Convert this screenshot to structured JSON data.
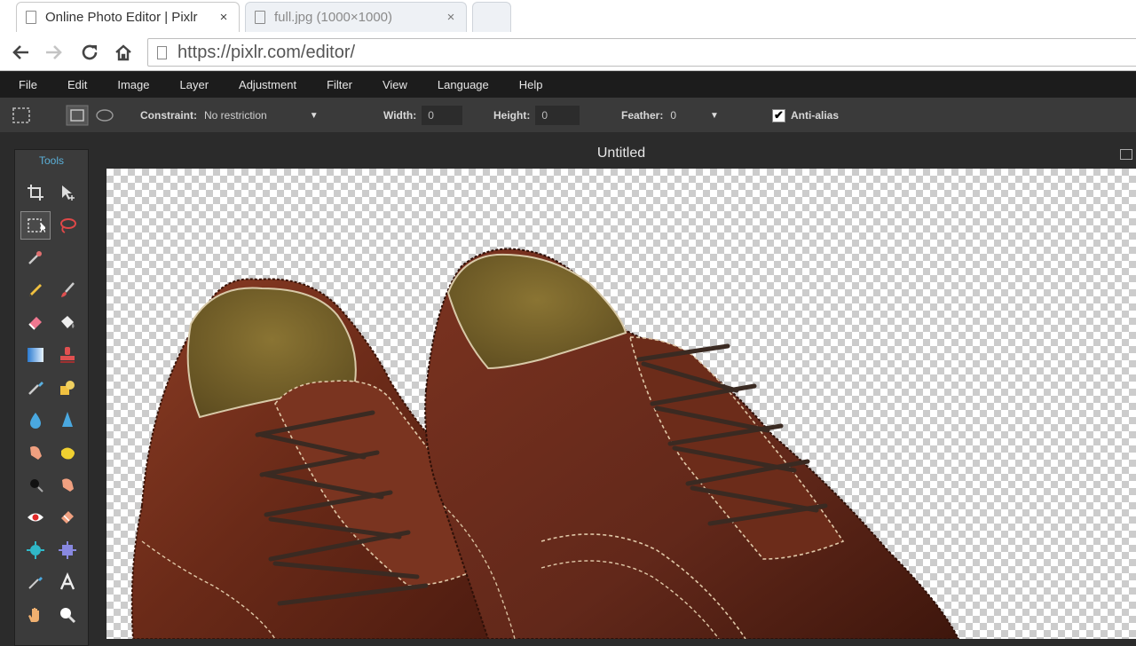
{
  "browser": {
    "tabs": [
      {
        "title": "Online Photo Editor | Pixlr",
        "close": "×"
      },
      {
        "title": "full.jpg (1000×1000)",
        "close": "×"
      }
    ],
    "url": "https://pixlr.com/editor/"
  },
  "menu": [
    "File",
    "Edit",
    "Image",
    "Layer",
    "Adjustment",
    "Filter",
    "View",
    "Language",
    "Help"
  ],
  "options": {
    "constraint_label": "Constraint:",
    "constraint_value": "No restriction",
    "width_label": "Width:",
    "width_value": "0",
    "height_label": "Height:",
    "height_value": "0",
    "feather_label": "Feather:",
    "feather_value": "0",
    "antialias_label": "Anti-alias",
    "antialias_checked": true
  },
  "tools": {
    "title": "Tools",
    "icons": [
      "crop-icon",
      "move-icon",
      "marquee-icon",
      "lasso-icon",
      "wand-icon",
      "",
      "pencil-icon",
      "brush-icon",
      "eraser-icon",
      "bucket-icon",
      "gradient-icon",
      "stamp-icon",
      "colorreplace-icon",
      "drawing-icon",
      "blur-icon",
      "sharpen-icon",
      "smudge-icon",
      "sponge-icon",
      "burn-icon",
      "dodge-icon",
      "redeye-icon",
      "spotheal-icon",
      "bloat-icon",
      "pinch-icon",
      "colorpicker-icon",
      "text-icon",
      "hand-icon",
      "zoom-icon"
    ]
  },
  "document": {
    "title": "Untitled"
  },
  "colors": {
    "menubar": "#1c1c1c",
    "optionsbar": "#3a3a3a",
    "tools_title": "#5bb0d8",
    "leather": "#6e2d1c"
  }
}
